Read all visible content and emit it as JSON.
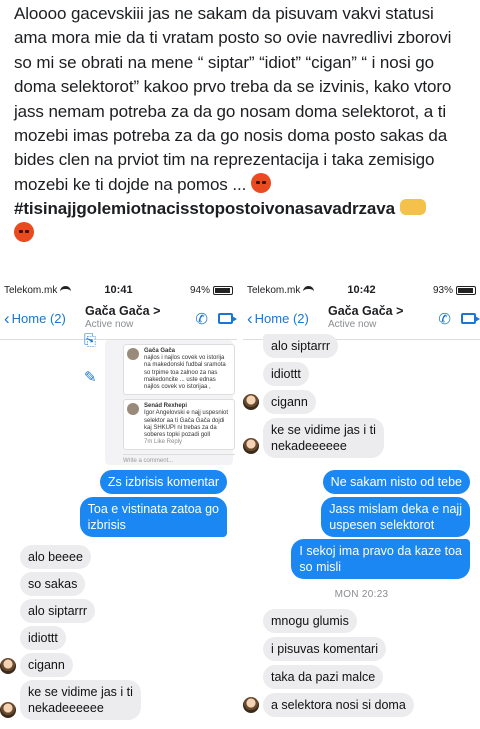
{
  "post": {
    "text": "Aloooo gacevskiii  jas ne sakam da pisuvam vakvi statusi ama mora mie da ti vratam posto so ovie navredlivi zborovi so mi se obrati na mene “ siptar” “idiot” “cigan” “ i nosi go doma selektorot”  kakoo prvo treba da se izvinis, kako vtoro jass nemam potreba za da go nosam doma selektorot, a ti mozebi imas potreba za da go nosis doma posto sakas da bides clen na prviot tim na reprezentacija i taka zemisigo mozebi ke ti dojde na pomos ...",
    "hashtag": "#tisinajjgolemiotnacisstopostoivonasavadrzava",
    "emoji_angry": "angry-face",
    "emoji_handshake": "handshake"
  },
  "left": {
    "carrier": "Telekom.mk",
    "time": "10:41",
    "battery": "94%",
    "battery_level": 0.94,
    "back": "Home (2)",
    "contact": "Gača Gača",
    "chevron": ">",
    "active": "Active now",
    "embed": {
      "c1_name": "Gača Gača",
      "c1_text": "najlos i najlos covek vo istorija na makedonski fudbal sramota so trpime toa zalnoo za nas makedoncite ... uste ednas najlos covek vo istorijaa ,",
      "c2_name": "Senád Rexhepi",
      "c2_text": "Igor Angelovski e najj uspesniot selektor aa ti Gača Gača dojdi kaj SHKUPI ni trebas za da soberes topki pozadi goll",
      "c2_meta": "7m   Like   Reply",
      "write": "Write a comment..."
    },
    "out": [
      "Zs izbrisis komentar",
      "Toa e vistinata zatoa go",
      "izbrisis"
    ],
    "in": [
      "alo beeee",
      "so sakas",
      "alo siptarrr",
      "idiottt",
      "cigann",
      "ke se vidime jas i ti",
      "nekadeeeeee"
    ]
  },
  "right": {
    "carrier": "Telekom.mk",
    "time": "10:42",
    "battery": "93%",
    "battery_level": 0.93,
    "back": "Home (2)",
    "contact": "Gača Gača",
    "chevron": ">",
    "active": "Active now",
    "in_top": [
      "alo siptarrr",
      "idiottt",
      "cigann",
      "ke se vidime jas i ti",
      "nekadeeeeee"
    ],
    "out": [
      "Ne sakam nisto od tebe",
      "Jass mislam deka e najj",
      "uspesen selektorot",
      "I sekoj ima pravo da kaze toa",
      "so misli"
    ],
    "timestamp": "MON 20:23",
    "in_bottom": [
      "mnogu glumis",
      "i pisuvas komentari",
      "taka da pazi malce",
      "a selektora nosi si doma"
    ]
  },
  "colors": {
    "accent": "#1b87f2",
    "incoming": "#ececee"
  }
}
